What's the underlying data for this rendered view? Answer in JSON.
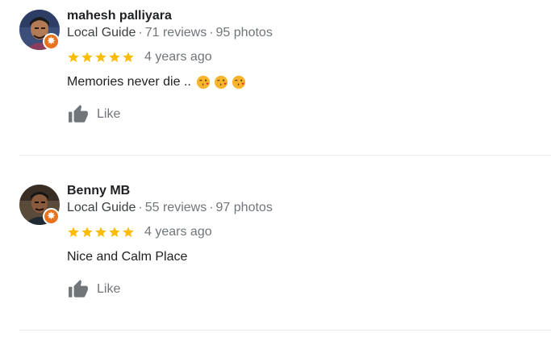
{
  "reviews": [
    {
      "name": "mahesh palliyara",
      "badge": "Local Guide",
      "reviews_count": "71 reviews",
      "photos_count": "95 photos",
      "rating": 5,
      "time_ago": "4 years ago",
      "text": "Memories never die ..",
      "emoji": [
        "face-blowing-kiss",
        "face-blowing-kiss",
        "face-blowing-kiss"
      ],
      "like_label": "Like"
    },
    {
      "name": "Benny MB",
      "badge": "Local Guide",
      "reviews_count": "55 reviews",
      "photos_count": "97 photos",
      "rating": 5,
      "time_ago": "4 years ago",
      "text": "Nice and Calm Place",
      "emoji": [],
      "like_label": "Like"
    }
  ],
  "separator": "·",
  "colors": {
    "star": "#fbbc04",
    "meta_text": "#70757a",
    "guide_badge": "#e8731f",
    "divider": "#e8eaed"
  },
  "icons": {
    "rating": "star-icon",
    "like": "thumbs-up-icon",
    "local_guide": "local-guide-badge-icon"
  }
}
